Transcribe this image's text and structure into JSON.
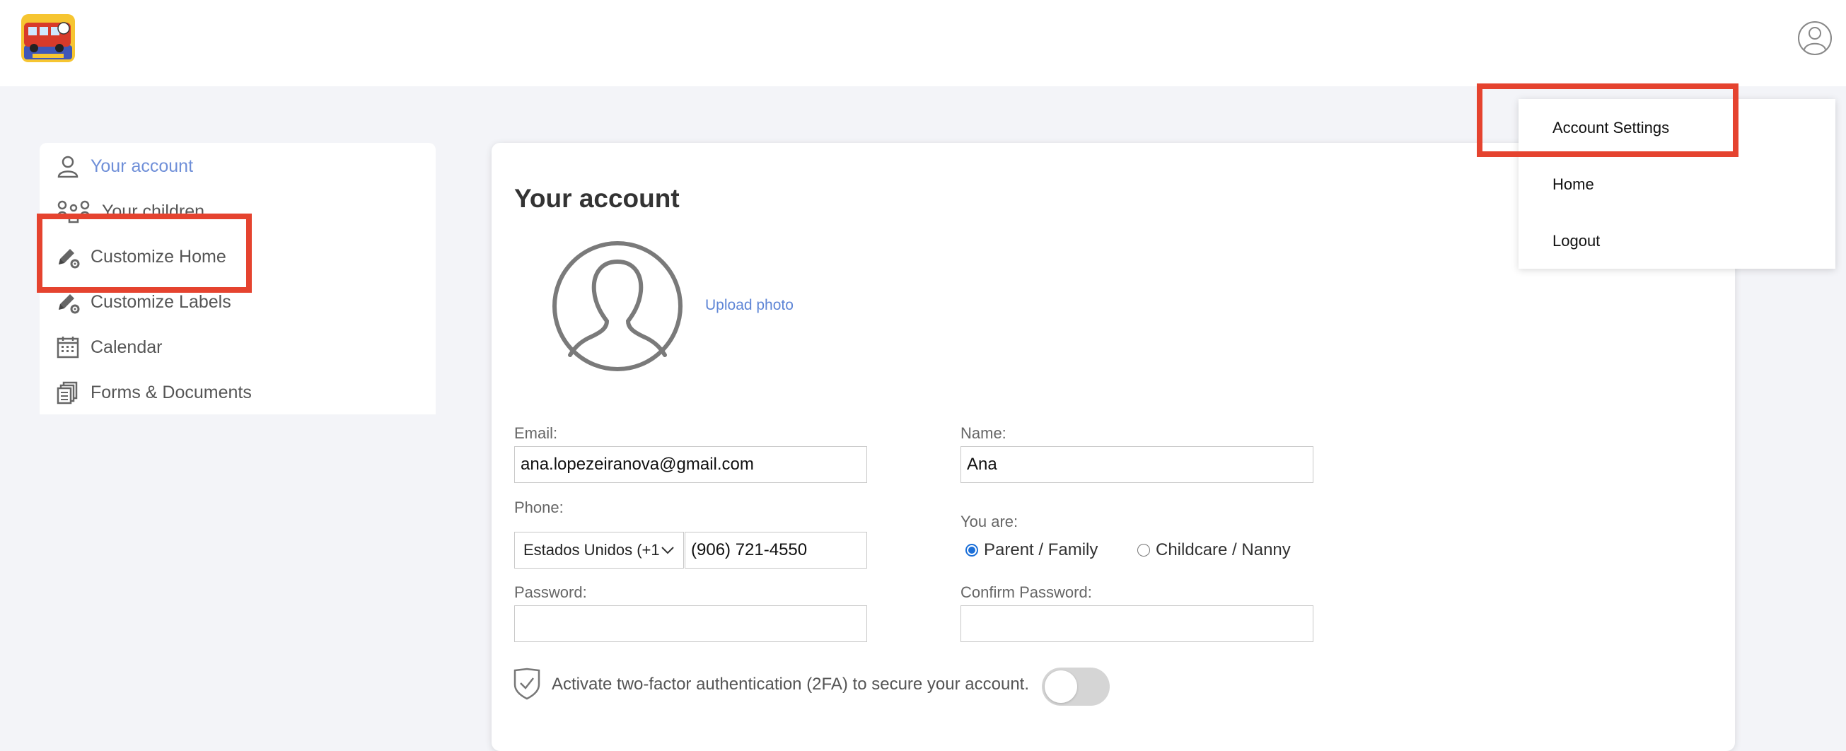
{
  "colors": {
    "accent": "#6f8fd8",
    "link": "#5f86d6",
    "highlight": "#e5432f",
    "background": "#f3f4f8"
  },
  "header": {
    "logo_icon": "magic-bus-logo",
    "user_icon": "user-circle-icon"
  },
  "sidebar": {
    "items": [
      {
        "label": "Your account",
        "icon": "user-icon"
      },
      {
        "label": "Your children",
        "icon": "family-icon"
      },
      {
        "label": "Customize Home",
        "icon": "pencil-gear-icon"
      },
      {
        "label": "Customize Labels",
        "icon": "pencil-gear-icon"
      },
      {
        "label": "Calendar",
        "icon": "calendar-icon"
      },
      {
        "label": "Forms & Documents",
        "icon": "documents-icon"
      }
    ]
  },
  "main": {
    "title": "Your account",
    "upload_photo": "Upload photo",
    "email_label": "Email:",
    "email_value": "ana.lopezeiranova@gmail.com",
    "name_label": "Name:",
    "name_value": "Ana",
    "phone_label": "Phone:",
    "country_selected": "Estados Unidos (+1",
    "phone_value": "(906) 721-4550",
    "you_are_label": "You are:",
    "role_options": [
      "Parent / Family",
      "Childcare / Nanny"
    ],
    "role_selected": "Parent / Family",
    "password_label": "Password:",
    "password_value": "",
    "confirm_password_label": "Confirm Password:",
    "confirm_password_value": "",
    "twofa_text": "Activate two-factor authentication (2FA) to secure your account.",
    "twofa_enabled": false
  },
  "dropdown": {
    "items": [
      "Account Settings",
      "Home",
      "Logout"
    ]
  }
}
